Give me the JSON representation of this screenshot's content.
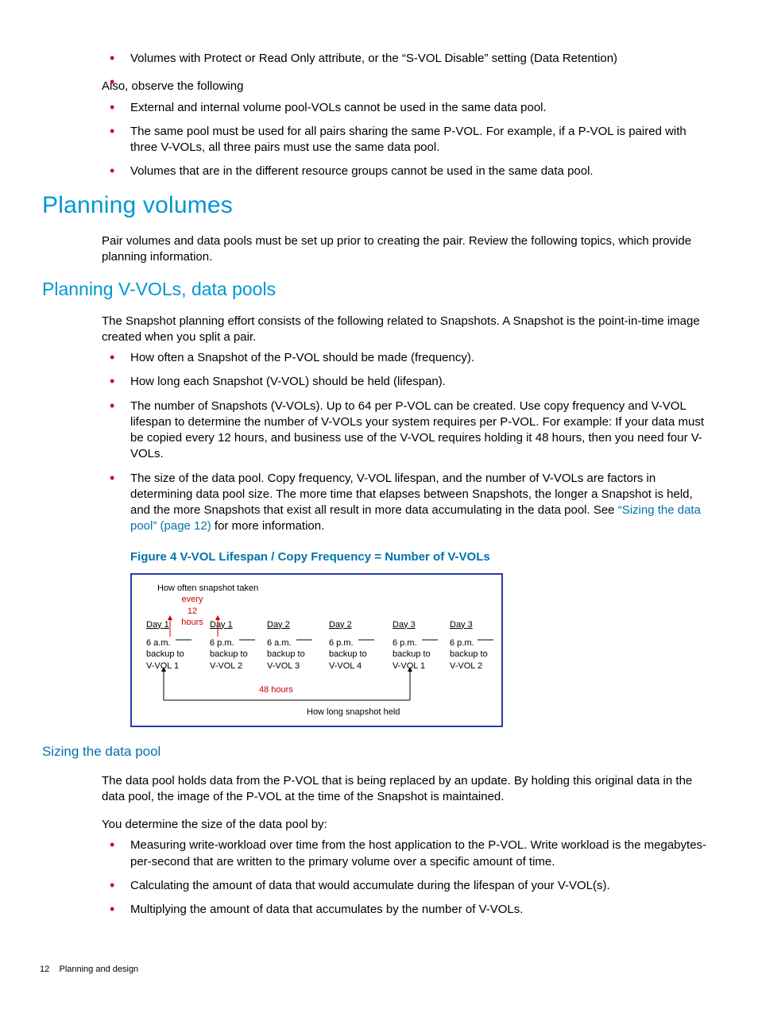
{
  "intro_bullets_top": [
    "Volumes with Protect or Read Only attribute, or the “S-VOL Disable” setting (Data Retention)",
    ""
  ],
  "also_line": "Also, observe the following",
  "also_bullets": [
    "External and internal volume pool-VOLs cannot be used in the same data pool.",
    "The same pool must be used for all pairs sharing the same P-VOL. For example, if a P-VOL is paired with three V-VOLs, all three pairs must use the same data pool.",
    "Volumes that are in the different resource groups cannot be used in the same data pool."
  ],
  "h1": "Planning volumes",
  "h1_para": "Pair volumes and data pools must be set up prior to creating the pair. Review the following topics, which provide planning information.",
  "h2": "Planning V-VOLs, data pools",
  "h2_para": "The Snapshot planning effort consists of the following related to Snapshots. A Snapshot is the point-in-time image created when you split a pair.",
  "h2_bullets": [
    "How often a Snapshot of the P-VOL should be made (frequency).",
    "How long each Snapshot (V-VOL) should be held (lifespan).",
    "The number of Snapshots (V-VOLs). Up to 64 per P-VOL can be created. Use copy frequency and V-VOL lifespan to determine the number of V-VOLs your system requires per P-VOL. For example: If your data must be copied every 12 hours, and business use of the V-VOL requires holding it 48 hours, then you need four V-VOLs."
  ],
  "h2_bullet4_pre": "The size of the data pool. Copy frequency, V-VOL lifespan, and the number of V-VOLs are factors in determining data pool size. The more time that elapses between Snapshots, the longer a Snapshot is held, and the more Snapshots that exist all result in more data accumulating in the data pool. See ",
  "h2_bullet4_link": "“Sizing the data pool” (page 12)",
  "h2_bullet4_post": " for more information.",
  "figure_caption": "Figure 4 V-VOL Lifespan / Copy Frequency = Number of V-VOLs",
  "figure": {
    "top_label": "How often snapshot taken",
    "red_top1": "every",
    "red_top2": "12",
    "red_top3": "hours",
    "red_mid": "48 hours",
    "bottom_label": "How long snapshot held",
    "cols": [
      {
        "day": "Day 1",
        "time": "6 a.m.",
        "b1": "backup to",
        "b2": "V-VOL 1"
      },
      {
        "day": "Day 1",
        "time": "6 p.m.",
        "b1": "backup to",
        "b2": "V-VOL 2"
      },
      {
        "day": "Day 2",
        "time": "6 a.m.",
        "b1": "backup to",
        "b2": "V-VOL 3"
      },
      {
        "day": "Day 2",
        "time": "6 p.m.",
        "b1": "backup to",
        "b2": "V-VOL 4"
      },
      {
        "day": "Day 3",
        "time": "6 p.m.",
        "b1": "backup to",
        "b2": "V-VOL 1"
      },
      {
        "day": "Day 3",
        "time": "6 p.m.",
        "b1": "backup to",
        "b2": "V-VOL 2"
      }
    ]
  },
  "h3": "Sizing the data pool",
  "h3_para1": "The data pool holds data from the P-VOL that is being replaced by an update. By holding this original data in the data pool, the image of the P-VOL at the time of the Snapshot is maintained.",
  "h3_para2": "You determine the size of the data pool by:",
  "h3_bullets": [
    "Measuring write-workload over time from the host application to the P-VOL. Write workload is the megabytes-per-second that are written to the primary volume over a specific amount of time.",
    "Calculating the amount of data that would accumulate during the lifespan of your V-VOL(s).",
    "Multiplying the amount of data that accumulates by the number of V-VOLs."
  ],
  "footer_page": "12",
  "footer_section": "Planning and design"
}
